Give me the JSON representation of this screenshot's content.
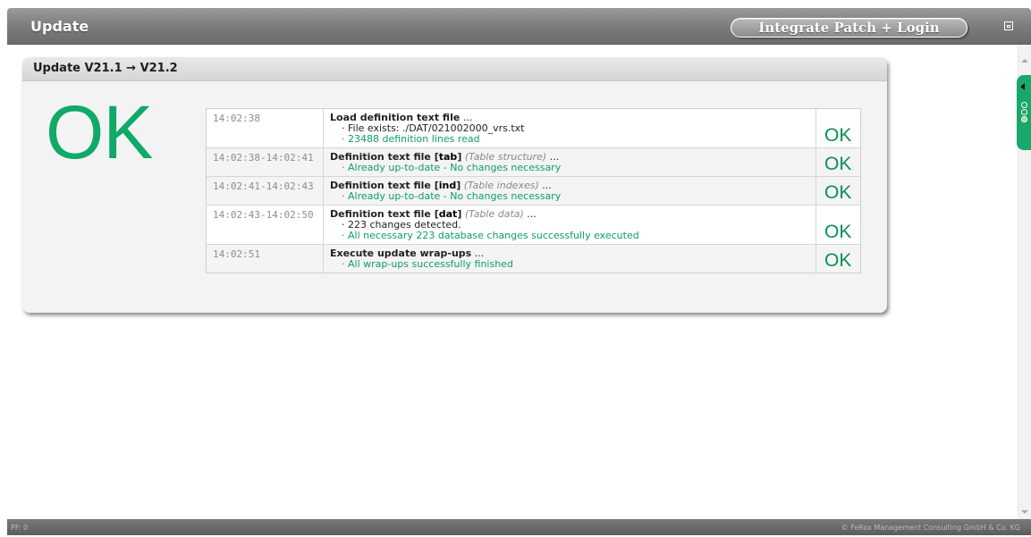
{
  "window": {
    "title": "Update",
    "action_button": "Integrate Patch + Login",
    "status_left": "PF: 0",
    "status_right": "© FeRox Management Consulting GmbH & Co. KG"
  },
  "panel": {
    "title": "Update V21.1 → V21.2",
    "overall_status": "OK"
  },
  "steps": [
    {
      "time": "14:02:38",
      "title": "Load definition text file",
      "keyword": "",
      "qualifier": "",
      "ellipsis": " ...",
      "lines": [
        {
          "text": "· File exists: ./DAT/021002000_vrs.txt",
          "tone": "plain"
        },
        {
          "text": "· 23488 definition lines read",
          "tone": "ok"
        }
      ],
      "status": "OK"
    },
    {
      "time": "14:02:38-14:02:41",
      "title": "Definition text file [",
      "keyword": "tab",
      "title_end": "]",
      "qualifier": " (Table structure)",
      "ellipsis": " ...",
      "lines": [
        {
          "text": "· Already up-to-date - No changes necessary",
          "tone": "ok"
        }
      ],
      "status": "OK"
    },
    {
      "time": "14:02:41-14:02:43",
      "title": "Definition text file [",
      "keyword": "ind",
      "title_end": "]",
      "qualifier": " (Table indexes)",
      "ellipsis": " ...",
      "lines": [
        {
          "text": "· Already up-to-date - No changes necessary",
          "tone": "ok"
        }
      ],
      "status": "OK"
    },
    {
      "time": "14:02:43-14:02:50",
      "title": "Definition text file [",
      "keyword": "dat",
      "title_end": "]",
      "qualifier": " (Table data)",
      "ellipsis": " ...",
      "lines": [
        {
          "text": "· 223 changes detected.",
          "tone": "plain"
        },
        {
          "text": "· All necessary 223 database changes successfully executed",
          "tone": "ok"
        }
      ],
      "status": "OK"
    },
    {
      "time": "14:02:51",
      "title": "Execute update wrap-ups",
      "keyword": "",
      "qualifier": "",
      "ellipsis": " ...",
      "lines": [
        {
          "text": "· All wrap-ups successfully finished",
          "tone": "ok"
        }
      ],
      "status": "OK"
    }
  ],
  "colors": {
    "ok_green": "#0fa968",
    "titlebar": "#7d7d7d",
    "side_tab": "#1aa86a"
  },
  "icons": [
    "maximize-icon",
    "collapse-arrow-icon",
    "scroll-up-icon",
    "scroll-down-icon"
  ]
}
